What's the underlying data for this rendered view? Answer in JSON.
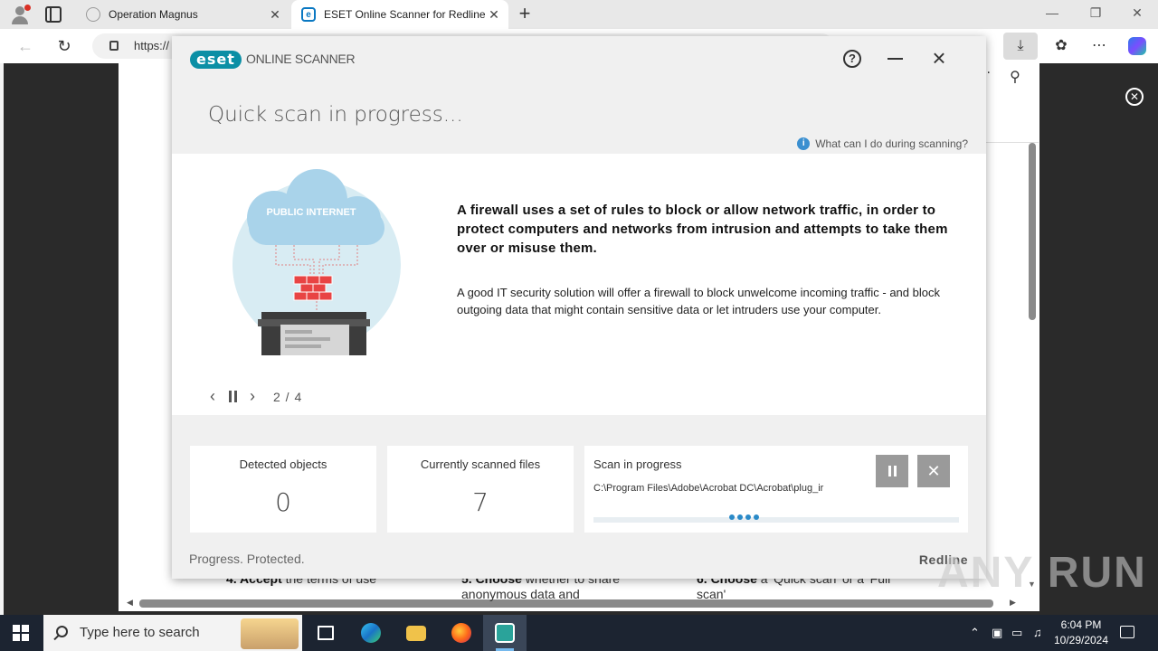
{
  "browser": {
    "tabs": [
      {
        "label": "Operation Magnus"
      },
      {
        "label": "ESET Online Scanner for Redline"
      }
    ],
    "address": "https://",
    "window_controls": {
      "minimize": "—",
      "restore": "❐",
      "close": "✕"
    }
  },
  "background_page": {
    "steps": [
      {
        "bold": "4. Accept",
        "text": " the terms of use"
      },
      {
        "bold": "5. Choose",
        "text": " whether to share anonymous data and"
      },
      {
        "bold": "6. Choose",
        "text": " a 'Quick scan' or a 'Full scan'"
      }
    ]
  },
  "eset": {
    "logo": "eset",
    "product": "ONLINE SCANNER",
    "title": "Quick scan in progress...",
    "info_link": "What can I do during scanning?",
    "illustration_label": "PUBLIC INTERNET",
    "slide": {
      "headline": "A firewall uses a set of rules to block or allow network traffic, in order to protect computers and networks from intrusion and attempts to take them over or misuse them.",
      "body": "A good IT security solution will offer a firewall to block unwelcome incoming traffic - and block outgoing data that might contain sensitive data or let intruders use your computer.",
      "counter": "2 / 4"
    },
    "stats": {
      "detected_label": "Detected objects",
      "detected_value": "0",
      "files_label": "Currently scanned files",
      "files_value": "7",
      "progress_label": "Scan in progress",
      "current_path": "C:\\Program Files\\Adobe\\Acrobat DC\\Acrobat\\plug_ir"
    },
    "tagline": "Progress. Protected.",
    "brand": "Redline"
  },
  "watermark": "ANY RUN",
  "taskbar": {
    "search_placeholder": "Type here to search",
    "time": "6:04 PM",
    "date": "10/29/2024"
  }
}
